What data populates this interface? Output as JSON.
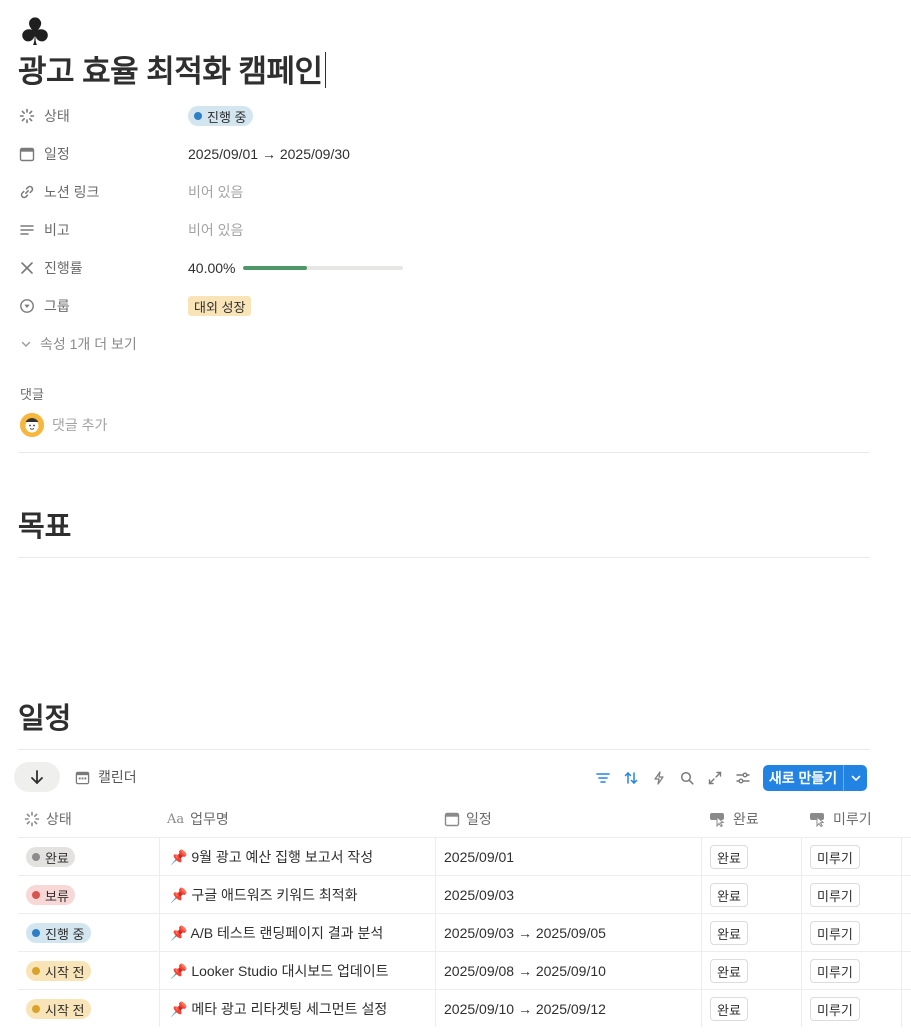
{
  "page": {
    "icon": "♣",
    "title": "광고 효율 최적화 캠페인"
  },
  "properties": {
    "status": {
      "label": "상태",
      "value": "진행 중"
    },
    "schedule": {
      "label": "일정",
      "value": "2025/09/01 → 2025/09/30"
    },
    "notion_link": {
      "label": "노션 링크",
      "value": "비어 있음"
    },
    "note": {
      "label": "비고",
      "value": "비어 있음"
    },
    "progress": {
      "label": "진행률",
      "value": "40.00%",
      "fraction": 0.4
    },
    "group": {
      "label": "그룹",
      "value": "대외 성장"
    },
    "show_more": "속성 1개 더 보기"
  },
  "comments": {
    "label": "댓글",
    "add_placeholder": "댓글 추가"
  },
  "sections": {
    "goal": "목표",
    "schedule": "일정"
  },
  "database": {
    "view_label": "캘린더",
    "new_button": "새로 만들기",
    "columns": {
      "status": "상태",
      "task": "업무명",
      "date": "일정",
      "done": "완료",
      "postpone": "미루기"
    },
    "rows": [
      {
        "status": "완료",
        "task": "📌 9월 광고 예산 집행 보고서 작성",
        "date": "2025/09/01",
        "done": "완료",
        "postpone": "미루기"
      },
      {
        "status": "보류",
        "task": "📌 구글 애드워즈 키워드 최적화",
        "date": "2025/09/03",
        "done": "완료",
        "postpone": "미루기"
      },
      {
        "status": "진행 중",
        "task": "📌 A/B 테스트 랜딩페이지 결과 분석",
        "date": "2025/09/03 → 2025/09/05",
        "done": "완료",
        "postpone": "미루기"
      },
      {
        "status": "시작 전",
        "task": "📌 Looker Studio 대시보드 업데이트",
        "date": "2025/09/08 → 2025/09/10",
        "done": "완료",
        "postpone": "미루기"
      },
      {
        "status": "시작 전",
        "task": "📌 메타 광고 리타겟팅 세그먼트 설정",
        "date": "2025/09/10 → 2025/09/12",
        "done": "완료",
        "postpone": "미루기"
      }
    ]
  },
  "colors": {
    "accent": "#2383e2",
    "progress_fill": "#4f9768",
    "status_in_progress_bg": "#d3e5ef",
    "status_in_progress_dot": "#2e7fc7",
    "status_done_bg": "#e3e2e0",
    "status_done_dot": "#8c8c8c",
    "status_hold_bg": "#f8d8d6",
    "status_hold_dot": "#d9534f",
    "status_todo_bg": "#f9e4b8",
    "status_todo_dot": "#d9a22b",
    "group_tag_bg": "#f9e4b8"
  }
}
